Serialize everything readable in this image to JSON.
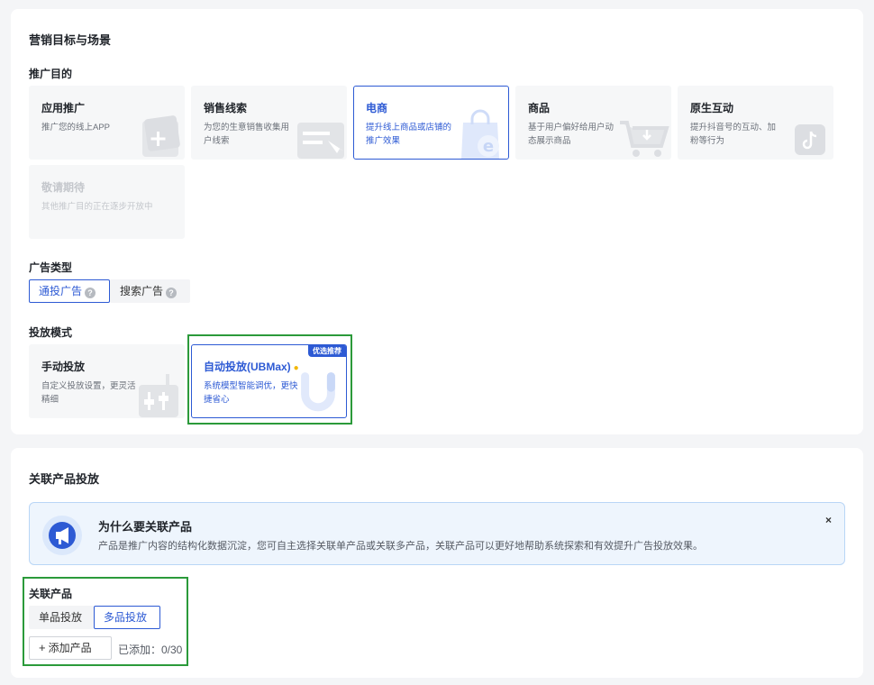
{
  "marketing": {
    "title": "营销目标与场景",
    "purpose_label": "推广目的",
    "goals": [
      {
        "title": "应用推广",
        "desc": "推广您的线上APP",
        "icon": "plus-icon"
      },
      {
        "title": "销售线索",
        "desc": "为您的生意销售收集用户线索",
        "icon": "form-icon"
      },
      {
        "title": "电商",
        "desc": "提升线上商品或店铺的推广效果",
        "icon": "shopping-bag-icon"
      },
      {
        "title": "商品",
        "desc": "基于用户偏好给用户动态展示商品",
        "icon": "cart-icon"
      },
      {
        "title": "原生互动",
        "desc": "提升抖音号的互动、加粉等行为",
        "icon": "tiktok-icon"
      },
      {
        "title": "敬请期待",
        "desc": "其他推广目的正在逐步开放中",
        "icon": ""
      }
    ],
    "ad_type_label": "广告类型",
    "ad_types": [
      {
        "label": "通投广告",
        "help": "?"
      },
      {
        "label": "搜索广告",
        "help": "?"
      }
    ],
    "mode_label": "投放模式",
    "modes": [
      {
        "title": "手动投放",
        "desc": "自定义投放设置，更灵活精细",
        "icon": "settings-slider-icon"
      },
      {
        "title": "自动投放(UBMax)",
        "desc": "系统模型智能调优，更快捷省心",
        "badge": "优选推荐",
        "icon": "ubmax-logo-icon"
      }
    ]
  },
  "related": {
    "title": "关联产品投放",
    "notice": {
      "title": "为什么要关联产品",
      "text": "产品是推广内容的结构化数据沉淀，您可自主选择关联单产品或关联多产品，关联产品可以更好地帮助系统探索和有效提升广告投放效果。",
      "close": "×"
    },
    "product_label": "关联产品",
    "tabs": [
      "单品投放",
      "多品投放"
    ],
    "add_button": "添加产品",
    "added_label": "已添加：0/30"
  },
  "colors": {
    "accent": "#2d5ad4",
    "highlight": "#2b9a3a"
  }
}
